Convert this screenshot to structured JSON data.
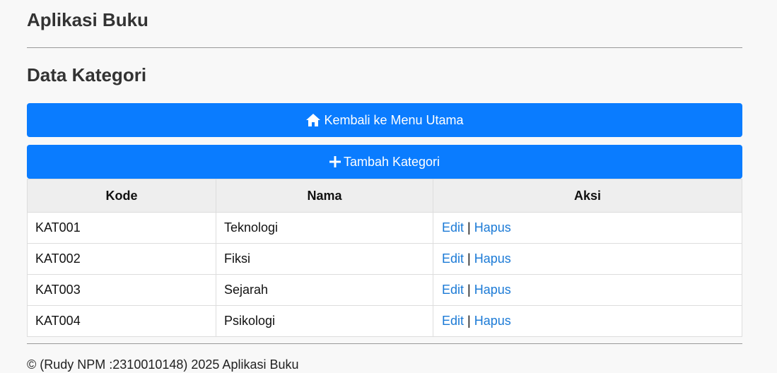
{
  "header": {
    "app_title": "Aplikasi Buku"
  },
  "page": {
    "title": "Data Kategori"
  },
  "buttons": {
    "home_label": "Kembali ke Menu Utama",
    "home_icon": "home-icon",
    "add_label": "Tambah Kategori",
    "add_icon": "plus-icon"
  },
  "table": {
    "headers": [
      "Kode",
      "Nama",
      "Aksi"
    ],
    "rows": [
      {
        "kode": "KAT001",
        "nama": "Teknologi"
      },
      {
        "kode": "KAT002",
        "nama": "Fiksi"
      },
      {
        "kode": "KAT003",
        "nama": "Sejarah"
      },
      {
        "kode": "KAT004",
        "nama": "Psikologi"
      }
    ],
    "edit_label": "Edit",
    "delete_label": "Hapus",
    "separator": "|"
  },
  "footer": {
    "text": "© (Rudy NPM :2310010148) 2025 Aplikasi Buku"
  },
  "colors": {
    "primary": "#0a7cff",
    "link": "#1b7ad6",
    "background": "#f8f8f8"
  }
}
